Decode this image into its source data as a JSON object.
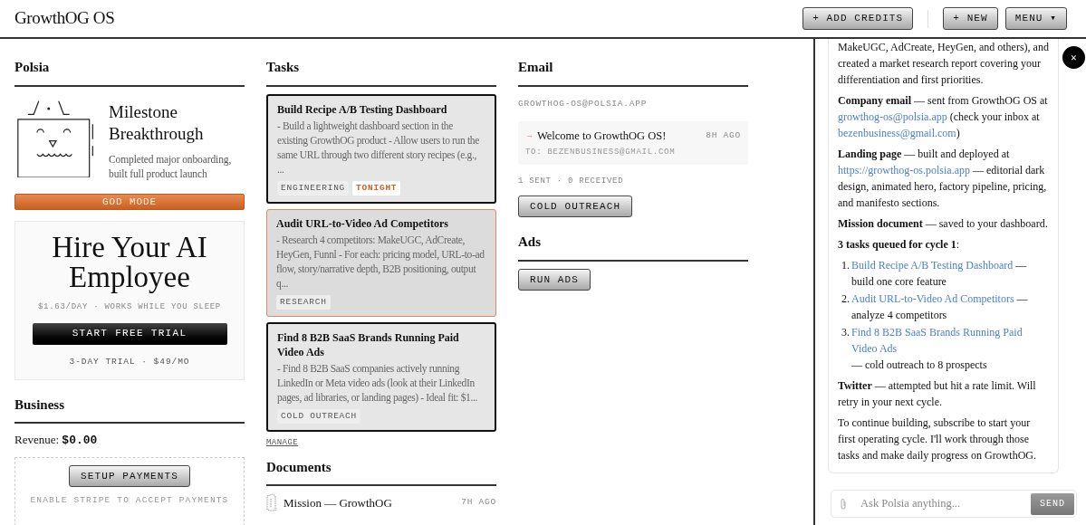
{
  "header": {
    "title": "GrowthOG OS",
    "buttons": [
      {
        "label": "+ ADD CREDITS"
      },
      {
        "label": "+ NEW"
      },
      {
        "label": "MENU ▾"
      }
    ]
  },
  "polsia": {
    "title": "Polsia",
    "milestone_title": "Milestone Breakthrough",
    "milestone_text": "Completed major onboarding, built full product launch",
    "god_mode": "GOD MODE"
  },
  "promo": {
    "title": "Hire Your AI Employee",
    "subtitle": "$1.63/DAY · WORKS WHILE YOU SLEEP",
    "cta": "START FREE TRIAL",
    "note": "3-DAY TRIAL · $49/MO"
  },
  "business": {
    "title": "Business",
    "revenue_label": "Revenue:",
    "revenue_value": "$0.00",
    "setup_button": "SETUP PAYMENTS",
    "setup_note": "ENABLE STRIPE TO ACCEPT PAYMENTS"
  },
  "tasks": {
    "title": "Tasks",
    "items": [
      {
        "title": "Build Recipe A/B Testing Dashboard",
        "description": "- Build a lightweight dashboard section in the existing GrowthOG product - Allow users to run the same URL through two different story recipes (e.g., ...",
        "highlighted": false,
        "tags": [
          {
            "kind": "category",
            "label": "ENGINEERING"
          },
          {
            "kind": "schedule",
            "label": "TONIGHT"
          }
        ]
      },
      {
        "title": "Audit URL-to-Video Ad Competitors",
        "description": "- Research 4 competitors: MakeUGC, AdCreate, HeyGen, Funnl - For each: pricing model, URL-to-ad flow, story/narrative depth, B2B positioning, output q...",
        "highlighted": true,
        "tags": [
          {
            "kind": "category",
            "label": "RESEARCH"
          }
        ]
      },
      {
        "title": "Find 8 B2B SaaS Brands Running Paid Video Ads",
        "description": "- Find 8 B2B SaaS companies actively running LinkedIn or Meta video ads (look at their LinkedIn pages, ad libraries, or landing pages) - Ideal fit: $1...",
        "highlighted": false,
        "tags": [
          {
            "kind": "category",
            "label": "COLD OUTREACH"
          }
        ]
      }
    ],
    "manage": "MANAGE"
  },
  "documents": {
    "title": "Documents",
    "items": [
      {
        "title": "Mission — GrowthOG",
        "time": "7H AGO"
      }
    ]
  },
  "email": {
    "title": "Email",
    "address": "GROWTHOG-OS@POLSIA.APP",
    "messages": [
      {
        "direction": "→",
        "subject": "Welcome to GrowthOG OS!",
        "time": "8H AGO",
        "to": "TO: BEZENBUSINESS@GMAIL.COM"
      }
    ],
    "stats": "1 SENT · 0 RECEIVED",
    "button": "COLD OUTREACH"
  },
  "ads": {
    "title": "Ads",
    "button": "RUN ADS"
  },
  "chat": {
    "close": "×",
    "blocks": [
      {
        "kind": "paragraph",
        "parts": [
          {
            "kind": "text",
            "text": "MakeUGC, AdCreate, HeyGen, and others), and created a market research report covering your differentiation and first priorities."
          }
        ]
      },
      {
        "kind": "paragraph",
        "parts": [
          {
            "kind": "text",
            "text": "**Company email** — sent from GrowthOG OS at "
          },
          {
            "kind": "link",
            "text": "growthog-os@polsia.app"
          },
          {
            "kind": "text",
            "text": " (check your inbox at "
          },
          {
            "kind": "link",
            "text": "bezenbusiness@gmail.com"
          },
          {
            "kind": "text",
            "text": ")"
          }
        ]
      },
      {
        "kind": "paragraph",
        "parts": [
          {
            "kind": "text",
            "text": "**Landing page** — built and deployed at "
          },
          {
            "kind": "link",
            "text": "https://growthog-os.polsia.app"
          },
          {
            "kind": "text",
            "text": " — editorial dark design, animated hero, factory pipeline, pricing, and manifesto sections."
          }
        ]
      },
      {
        "kind": "paragraph",
        "parts": [
          {
            "kind": "text",
            "text": "**Mission document** — saved to your dashboard."
          }
        ]
      },
      {
        "kind": "paragraph",
        "parts": [
          {
            "kind": "text",
            "text": "**3 tasks queued for cycle 1**:"
          }
        ]
      },
      {
        "kind": "list",
        "items": [
          {
            "number": "1.",
            "parts": [
              {
                "kind": "link",
                "text": "Build Recipe A/B Testing Dashboard"
              },
              {
                "kind": "text",
                "text": " — build one core feature"
              }
            ]
          },
          {
            "number": "2.",
            "parts": [
              {
                "kind": "link",
                "text": "Audit URL-to-Video Ad Competitors"
              },
              {
                "kind": "text",
                "text": " — analyze 4 competitors"
              }
            ]
          },
          {
            "number": "3.",
            "parts": [
              {
                "kind": "link",
                "text": "Find 8 B2B SaaS Brands Running Paid Video Ads"
              },
              {
                "kind": "text",
                "text": " — cold outreach to 8 prospects"
              }
            ]
          }
        ]
      },
      {
        "kind": "paragraph",
        "parts": [
          {
            "kind": "text",
            "text": "**Twitter** — attempted but hit a rate limit. Will retry in your next cycle."
          }
        ]
      },
      {
        "kind": "paragraph",
        "parts": [
          {
            "kind": "text",
            "text": "To continue building, subscribe to start your first operating cycle. I'll work through those tasks and make daily progress on GrowthOG."
          }
        ]
      }
    ],
    "input": {
      "placeholder": "Ask Polsia anything..."
    },
    "send": "SEND"
  }
}
